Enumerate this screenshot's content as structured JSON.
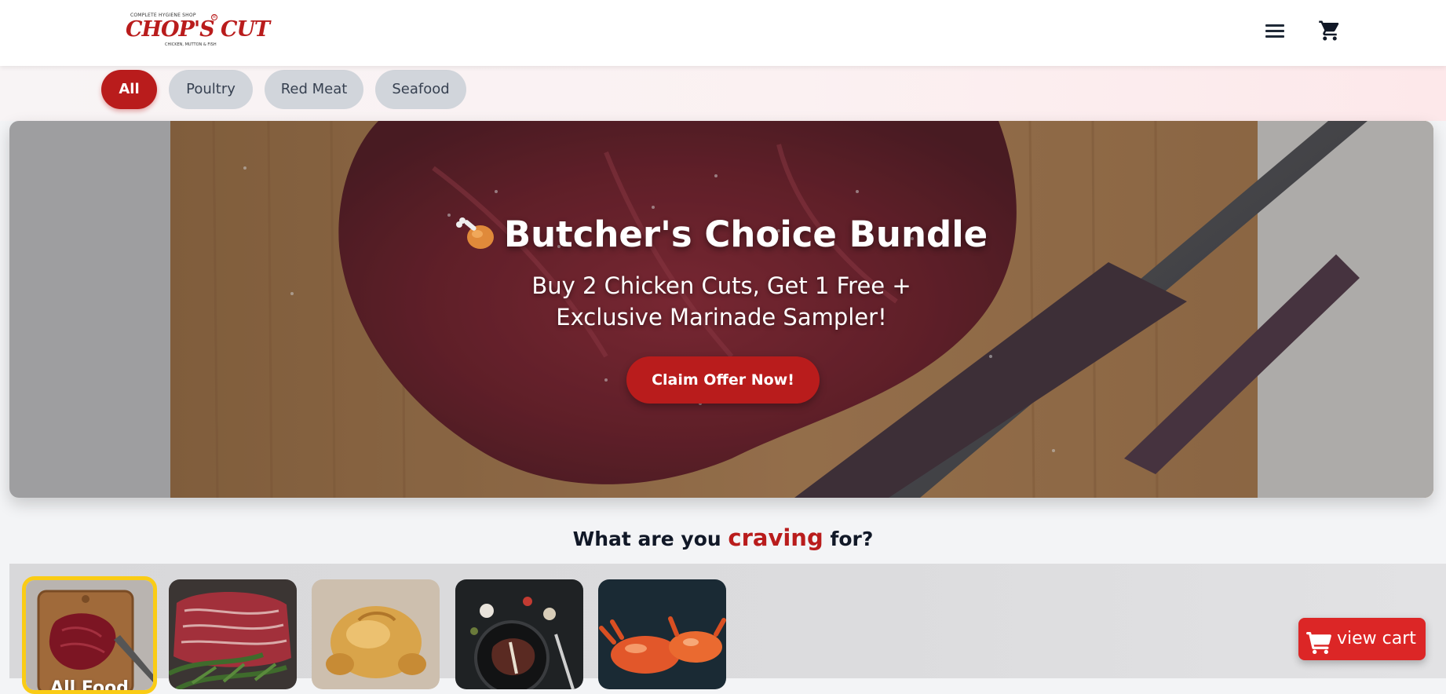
{
  "brand": {
    "tagline_top": "COMPLETE HYGIENE SHOP",
    "name": "CHOP'S CUT",
    "tagline_bottom": "CHICKEN, MUTTON & FISH",
    "accent_color": "#b91c1c"
  },
  "header": {
    "menu_icon": "hamburger-menu-icon",
    "cart_icon": "shopping-cart-icon"
  },
  "filters": [
    {
      "label": "All",
      "active": true
    },
    {
      "label": "Poultry",
      "active": false
    },
    {
      "label": "Red Meat",
      "active": false
    },
    {
      "label": "Seafood",
      "active": false
    }
  ],
  "hero": {
    "emoji_icon": "poultry-leg-icon",
    "title": "Butcher's Choice Bundle",
    "subtitle": "Buy 2 Chicken Cuts, Get 1 Free + Exclusive Marinade Sampler!",
    "cta_label": "Claim Offer Now!"
  },
  "craving": {
    "prefix": "What are you",
    "accent": "craving",
    "suffix": "for?",
    "categories": [
      {
        "label": "All Food",
        "image": "raw-steak-on-board",
        "selected": true
      },
      {
        "label": "",
        "image": "marbled-beef-rosemary",
        "selected": false
      },
      {
        "label": "",
        "image": "roast-chicken",
        "selected": false
      },
      {
        "label": "",
        "image": "t-bone-steak-pan",
        "selected": false
      },
      {
        "label": "",
        "image": "red-crabs",
        "selected": false
      }
    ]
  },
  "view_cart": {
    "label": "view cart",
    "icon": "shopping-cart-icon"
  }
}
